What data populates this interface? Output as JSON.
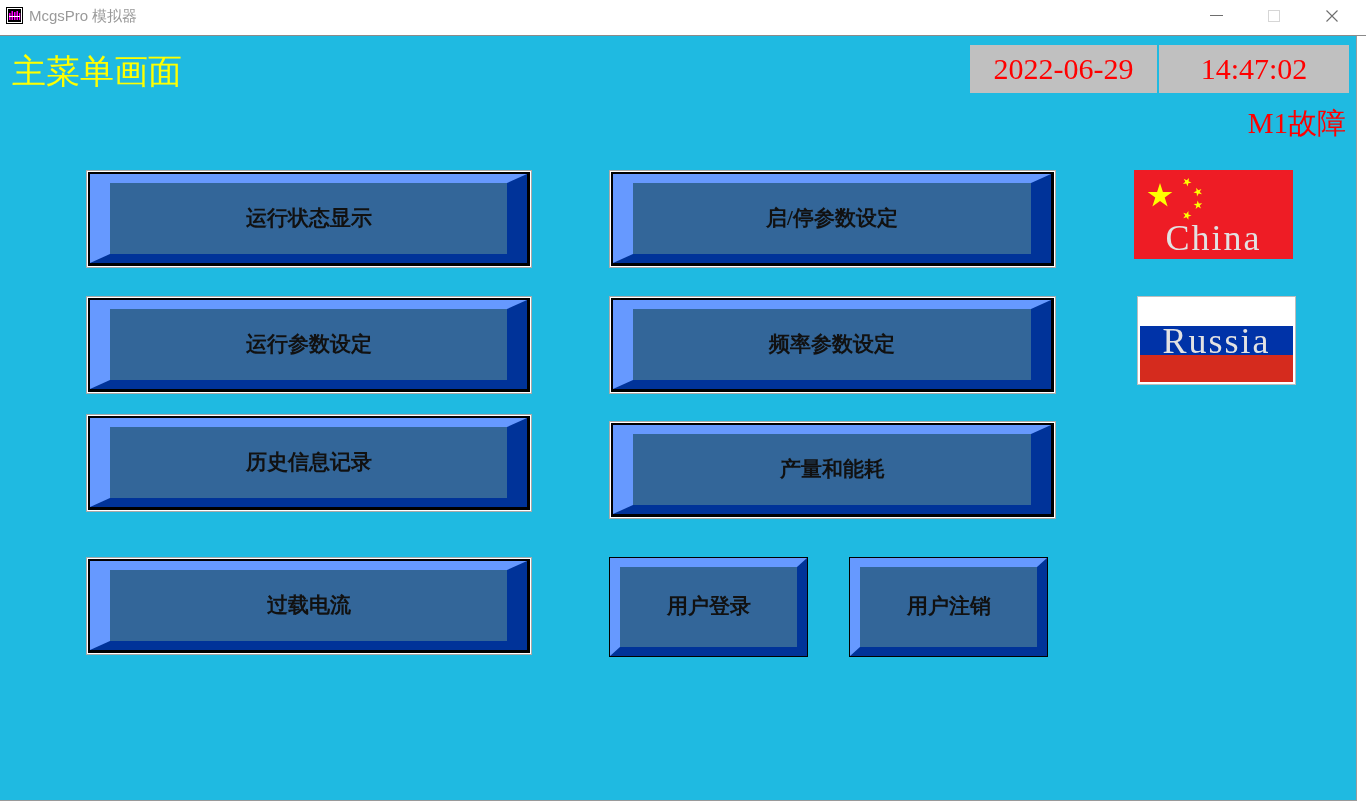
{
  "window": {
    "title": "McgsPro 模拟器",
    "controls": [
      {
        "kind": "minimize",
        "disabled": false
      },
      {
        "kind": "maximize",
        "disabled": true
      },
      {
        "kind": "close",
        "disabled": false
      }
    ]
  },
  "screen_title": "主菜单画面",
  "clock": {
    "date": "2022-06-29",
    "time": "14:47:02"
  },
  "alarm": "M1故障",
  "left_buttons": [
    "运行状态显示",
    "运行参数设定",
    "历史信息记录",
    "过载电流"
  ],
  "middle_buttons": [
    "启/停参数设定",
    "频率参数设定",
    "产量和能耗"
  ],
  "user_buttons": [
    "用户登录",
    "用户注销"
  ],
  "languages": [
    {
      "kind": "china",
      "label": "China"
    },
    {
      "kind": "russia",
      "label": "Russia"
    }
  ]
}
